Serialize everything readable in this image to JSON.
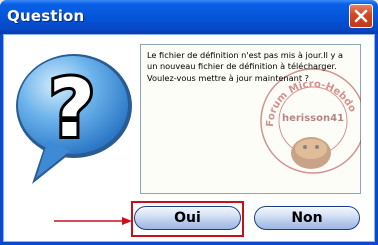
{
  "window": {
    "title": "Question",
    "close_icon": "close-icon"
  },
  "message": {
    "text": "Le fichier de définition n'est pas mis à jour.Il y a un nouveau fichier de définition à télécharger. Voulez-vous mettre à jour maintenant ?"
  },
  "watermark": {
    "arc_text": "Forum Micro-Hebdo",
    "name": "herisson41"
  },
  "buttons": {
    "yes_label": "Oui",
    "no_label": "Non"
  },
  "colors": {
    "titlebar": "#0555d9",
    "highlight": "#c8101b",
    "bubble": "#4a9de0"
  },
  "icons": [
    "question-bubble-icon",
    "close-icon",
    "arrow-right-icon"
  ]
}
